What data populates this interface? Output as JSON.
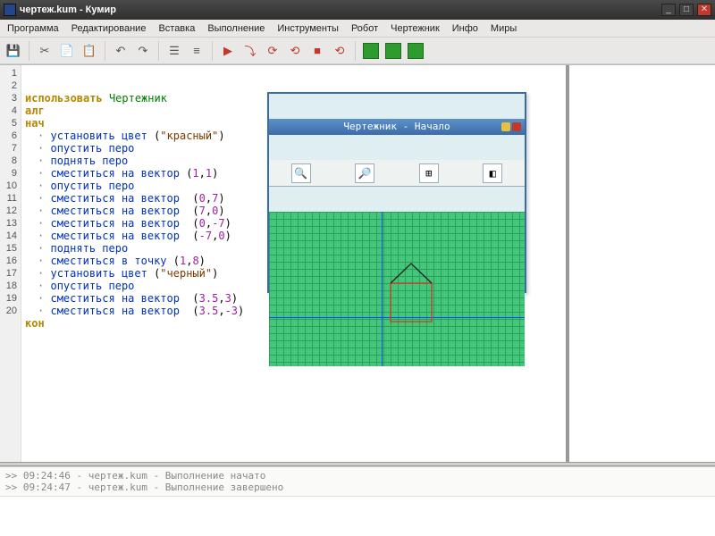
{
  "window": {
    "title": "чертеж.kum - Кумир"
  },
  "menu": [
    "Программа",
    "Редактирование",
    "Вставка",
    "Выполнение",
    "Инструменты",
    "Робот",
    "Чертежник",
    "Инфо",
    "Миры"
  ],
  "toolbar_icons": [
    "save-icon",
    "cut-icon",
    "copy-icon",
    "paste-icon",
    "undo-icon",
    "redo-icon",
    "list-icon",
    "list2-icon",
    "run-icon",
    "step-icon",
    "stepinto-icon",
    "stepout-icon",
    "stop-icon",
    "reset-icon",
    "grid1-icon",
    "grid2-icon",
    "grid3-icon"
  ],
  "code_lines": [
    {
      "n": 1,
      "html": "<span class='kw'>использовать</span> <span class='id'>Чертежник</span>"
    },
    {
      "n": 2,
      "html": "<span class='kw'>алг</span>"
    },
    {
      "n": 3,
      "html": "<span class='kw'>нач</span>"
    },
    {
      "n": 4,
      "html": "<span class='bullet'>·</span> <span class='cmd'>установить цвет</span> (<span class='str'>\"красный\"</span>)"
    },
    {
      "n": 5,
      "html": "<span class='bullet'>·</span> <span class='cmd'>опустить перо</span>"
    },
    {
      "n": 6,
      "html": "<span class='bullet'>·</span> <span class='cmd'>поднять перо</span>"
    },
    {
      "n": 7,
      "html": "<span class='bullet'>·</span> <span class='cmd'>сместиться на вектор</span> (<span class='num'>1</span>,<span class='num'>1</span>)"
    },
    {
      "n": 8,
      "html": "<span class='bullet'>·</span> <span class='cmd'>опустить перо</span>"
    },
    {
      "n": 9,
      "html": "<span class='bullet'>·</span> <span class='cmd'>сместиться на вектор</span>  (<span class='num'>0</span>,<span class='num'>7</span>)"
    },
    {
      "n": 10,
      "html": "<span class='bullet'>·</span> <span class='cmd'>сместиться на вектор</span>  (<span class='num'>7</span>,<span class='num'>0</span>)"
    },
    {
      "n": 11,
      "html": "<span class='bullet'>·</span> <span class='cmd'>сместиться на вектор</span>  (<span class='num'>0</span>,<span class='num'>-7</span>)"
    },
    {
      "n": 12,
      "html": "<span class='bullet'>·</span> <span class='cmd'>сместиться на вектор</span>  (<span class='num'>-7</span>,<span class='num'>0</span>)"
    },
    {
      "n": 13,
      "html": "<span class='bullet'>·</span> <span class='cmd'>поднять перо</span>"
    },
    {
      "n": 14,
      "html": "<span class='bullet'>·</span> <span class='cmd'>сместиться в точку</span> (<span class='num'>1</span>,<span class='num'>8</span>)"
    },
    {
      "n": 15,
      "html": "<span class='bullet'>·</span> <span class='cmd'>установить цвет</span> (<span class='str'>\"черный\"</span>)"
    },
    {
      "n": 16,
      "html": "<span class='bullet'>·</span> <span class='cmd'>опустить перо</span>"
    },
    {
      "n": 17,
      "html": "<span class='bullet'>·</span> <span class='cmd'>сместиться на вектор</span>  (<span class='num'>3.5</span>,<span class='num'>3</span>)"
    },
    {
      "n": 18,
      "html": "<span class='bullet'>·</span> <span class='cmd'>сместиться на вектор</span>  (<span class='num'>3.5</span>,<span class='num'>-3</span>)"
    },
    {
      "n": 19,
      "html": "<span class='kw'>кон</span>"
    },
    {
      "n": 20,
      "html": ""
    }
  ],
  "drawer": {
    "title": "Чертежник - Начало",
    "tools": [
      "zoom-in-icon",
      "zoom-out-icon",
      "grid-icon",
      "color-icon"
    ]
  },
  "console_lines": [
    ">> 09:24:46 - чертеж.kum - Выполнение начато",
    ">> 09:24:47 - чертеж.kum - Выполнение завершено"
  ]
}
